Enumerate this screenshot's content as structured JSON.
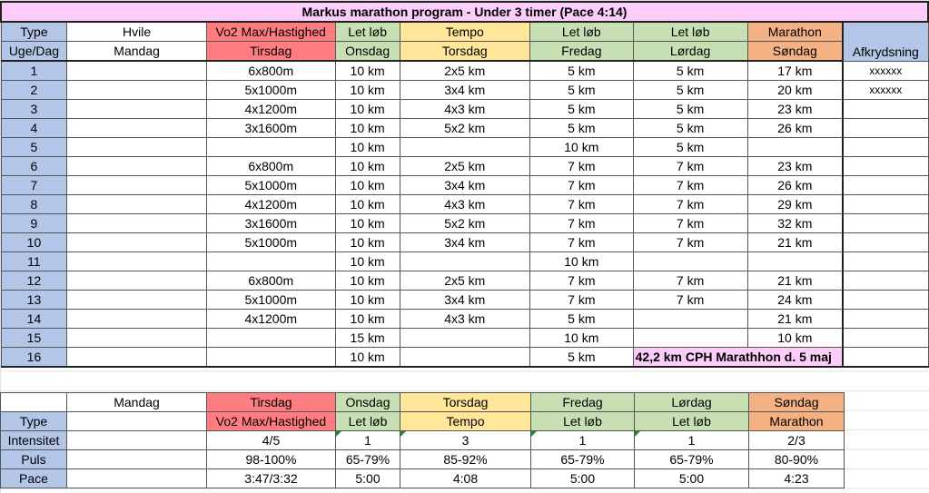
{
  "title": "Markus marathon program - Under 3 timer (Pace 4:14)",
  "header": {
    "type_label": "Type",
    "week_label": "Uge/Dag",
    "check_label": "Afkrydsning",
    "columns": [
      {
        "type": "Hvile",
        "day": "Mandag"
      },
      {
        "type": "Vo2 Max/Hastighed",
        "day": "Tirsdag"
      },
      {
        "type": "Let løb",
        "day": "Onsdag"
      },
      {
        "type": "Tempo",
        "day": "Torsdag"
      },
      {
        "type": "Let løb",
        "day": "Fredag"
      },
      {
        "type": "Let løb",
        "day": "Lørdag"
      },
      {
        "type": "Marathon",
        "day": "Søndag"
      }
    ]
  },
  "weeks": [
    {
      "week": "1",
      "mon": "",
      "tue": "6x800m",
      "wed": "10 km",
      "thu": "2x5 km",
      "fri": "5 km",
      "sat": "5 km",
      "sun": "17 km",
      "check": "xxxxxx"
    },
    {
      "week": "2",
      "mon": "",
      "tue": "5x1000m",
      "wed": "10 km",
      "thu": "3x4 km",
      "fri": "5 km",
      "sat": "5 km",
      "sun": "20 km",
      "check": "xxxxxx"
    },
    {
      "week": "3",
      "mon": "",
      "tue": "4x1200m",
      "wed": "10 km",
      "thu": "4x3 km",
      "fri": "5 km",
      "sat": "5 km",
      "sun": "23 km",
      "check": ""
    },
    {
      "week": "4",
      "mon": "",
      "tue": "3x1600m",
      "wed": "10 km",
      "thu": "5x2 km",
      "fri": "5 km",
      "sat": "5 km",
      "sun": "26 km",
      "check": ""
    },
    {
      "week": "5",
      "mon": "",
      "tue": "",
      "wed": "10 km",
      "thu": "",
      "fri": "10 km",
      "sat": "5 km",
      "sun": "",
      "check": ""
    },
    {
      "week": "6",
      "mon": "",
      "tue": "6x800m",
      "wed": "10 km",
      "thu": "2x5 km",
      "fri": "7 km",
      "sat": "7 km",
      "sun": "23 km",
      "check": ""
    },
    {
      "week": "7",
      "mon": "",
      "tue": "5x1000m",
      "wed": "10 km",
      "thu": "3x4 km",
      "fri": "7 km",
      "sat": "7 km",
      "sun": "26 km",
      "check": ""
    },
    {
      "week": "8",
      "mon": "",
      "tue": "4x1200m",
      "wed": "10 km",
      "thu": "4x3 km",
      "fri": "7 km",
      "sat": "7 km",
      "sun": "29 km",
      "check": ""
    },
    {
      "week": "9",
      "mon": "",
      "tue": "3x1600m",
      "wed": "10 km",
      "thu": "5x2 km",
      "fri": "7 km",
      "sat": "7 km",
      "sun": "32 km",
      "check": ""
    },
    {
      "week": "10",
      "mon": "",
      "tue": "5x1000m",
      "wed": "10 km",
      "thu": "3x4 km",
      "fri": "7 km",
      "sat": "7 km",
      "sun": "21 km",
      "check": ""
    },
    {
      "week": "11",
      "mon": "",
      "tue": "",
      "wed": "10 km",
      "thu": "",
      "fri": "10 km",
      "sat": "",
      "sun": "",
      "check": ""
    },
    {
      "week": "12",
      "mon": "",
      "tue": "6x800m",
      "wed": "10 km",
      "thu": "2x5 km",
      "fri": "7 km",
      "sat": "7 km",
      "sun": "21 km",
      "check": ""
    },
    {
      "week": "13",
      "mon": "",
      "tue": "5x1000m",
      "wed": "10 km",
      "thu": "3x4 km",
      "fri": "7 km",
      "sat": "7 km",
      "sun": "24 km",
      "check": ""
    },
    {
      "week": "14",
      "mon": "",
      "tue": "4x1200m",
      "wed": "10 km",
      "thu": "4x3 km",
      "fri": "5 km",
      "sat": "",
      "sun": "21 km",
      "check": ""
    },
    {
      "week": "15",
      "mon": "",
      "tue": "",
      "wed": "15 km",
      "thu": "",
      "fri": "10 km",
      "sat": "",
      "sun": "10 km",
      "check": ""
    },
    {
      "week": "16",
      "mon": "",
      "tue": "",
      "wed": "10 km",
      "thu": "",
      "fri": "5 km",
      "race": "42,2 km CPH Marathhon d. 5 maj",
      "check": ""
    }
  ],
  "legend": {
    "days": [
      "Mandag",
      "Tirsdag",
      "Onsdag",
      "Torsdag",
      "Fredag",
      "Lørdag",
      "Søndag"
    ],
    "rows": [
      {
        "label": "Type",
        "values": [
          "",
          "Vo2 Max/Hastighed",
          "Let løb",
          "Tempo",
          "Let løb",
          "Let løb",
          "Marathon"
        ]
      },
      {
        "label": "Intensitet",
        "values": [
          "",
          "4/5",
          "1",
          "3",
          "1",
          "1",
          "2/3"
        ]
      },
      {
        "label": "Puls",
        "values": [
          "",
          "98-100%",
          "65-79%",
          "85-92%",
          "65-79%",
          "65-79%",
          "80-90%"
        ]
      },
      {
        "label": "Pace",
        "values": [
          "",
          "3:47/3:32",
          "5:00",
          "4:08",
          "5:00",
          "5:00",
          "4:23"
        ]
      }
    ]
  },
  "colors": {
    "title_bg": "#fccdfa",
    "label_bg": "#b4c6e7",
    "vo2_bg": "#ff7c80",
    "easy_bg": "#c6e0b4",
    "tempo_bg": "#ffe699",
    "marathon_bg": "#f4b183"
  }
}
